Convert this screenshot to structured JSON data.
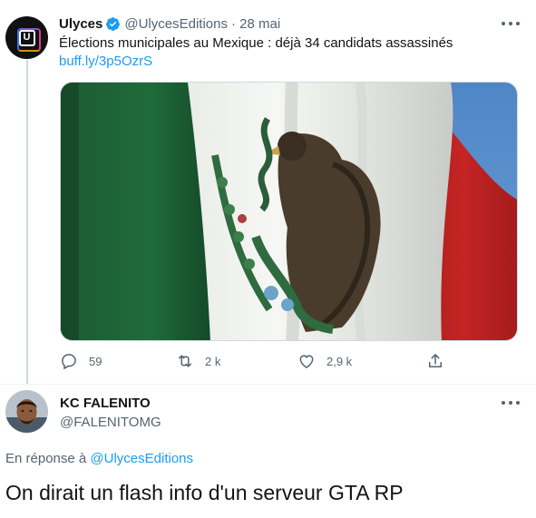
{
  "tweet": {
    "author": {
      "name": "Ulyces",
      "handle": "@UlycesEditions",
      "date": "· 28 mai",
      "avatar_letter": "U",
      "verified": true
    },
    "text": "Élections municipales au Mexique : déjà 34 candidats assassinés",
    "link": "buff.ly/3p5OzrS",
    "media_icon": "mexican-flag-photo",
    "actions": {
      "replies": "59",
      "retweets": "2 k",
      "likes": "2,9 k"
    }
  },
  "reply": {
    "author": {
      "name": "KC FALENITO",
      "handle": "@FALENITOMG"
    },
    "reply_prefix": "En réponse à",
    "reply_mention": "@UlycesEditions",
    "text": "On dirait un flash info d'un serveur GTA RP"
  },
  "colors": {
    "accent": "#1d9bf0",
    "secondary_text": "#536471",
    "border": "#cfd9de"
  }
}
